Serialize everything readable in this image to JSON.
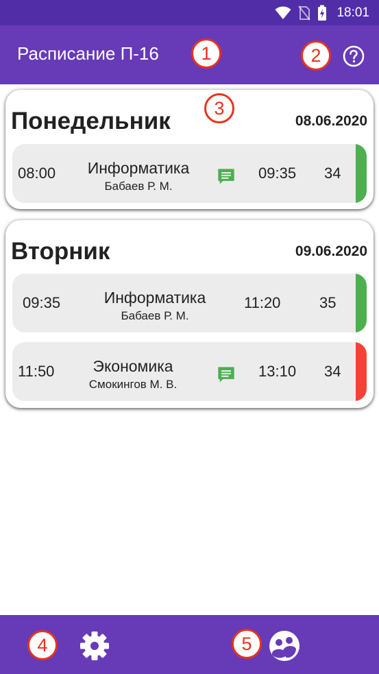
{
  "status_bar": {
    "time": "18:01",
    "icons": [
      "wifi-icon",
      "no-sim-icon",
      "battery-charging-icon"
    ]
  },
  "app_bar": {
    "title": "Расписание П-16",
    "help_icon": "help-circle-icon"
  },
  "annotation_markers": [
    "1",
    "2",
    "3",
    "4",
    "5"
  ],
  "schedule": [
    {
      "day": "Понедельник",
      "date": "08.06.2020",
      "lessons": [
        {
          "start": "08:00",
          "subject": "Информатика",
          "teacher": "Бабаев Р. М.",
          "end": "09:35",
          "room": "34",
          "has_comment": true,
          "status_color": "#4caf50"
        }
      ]
    },
    {
      "day": "Вторник",
      "date": "09.06.2020",
      "lessons": [
        {
          "start": "09:35",
          "subject": "Информатика",
          "teacher": "Бабаев Р. М.",
          "end": "11:20",
          "room": "35",
          "has_comment": false,
          "status_color": "#4caf50"
        },
        {
          "start": "11:50",
          "subject": "Экономика",
          "teacher": "Смокингов М. В.",
          "end": "13:10",
          "room": "34",
          "has_comment": true,
          "status_color": "#f44336"
        }
      ]
    }
  ],
  "bottom_bar": {
    "settings_icon": "gear-icon",
    "group_icon": "group-face-icon"
  },
  "colors": {
    "primary": "#673ab7",
    "primary_dark": "#512da8",
    "card_background": "#ffffff",
    "lesson_background": "#ececec",
    "comment_icon": "#4caf50",
    "marker": "#e8321e"
  }
}
